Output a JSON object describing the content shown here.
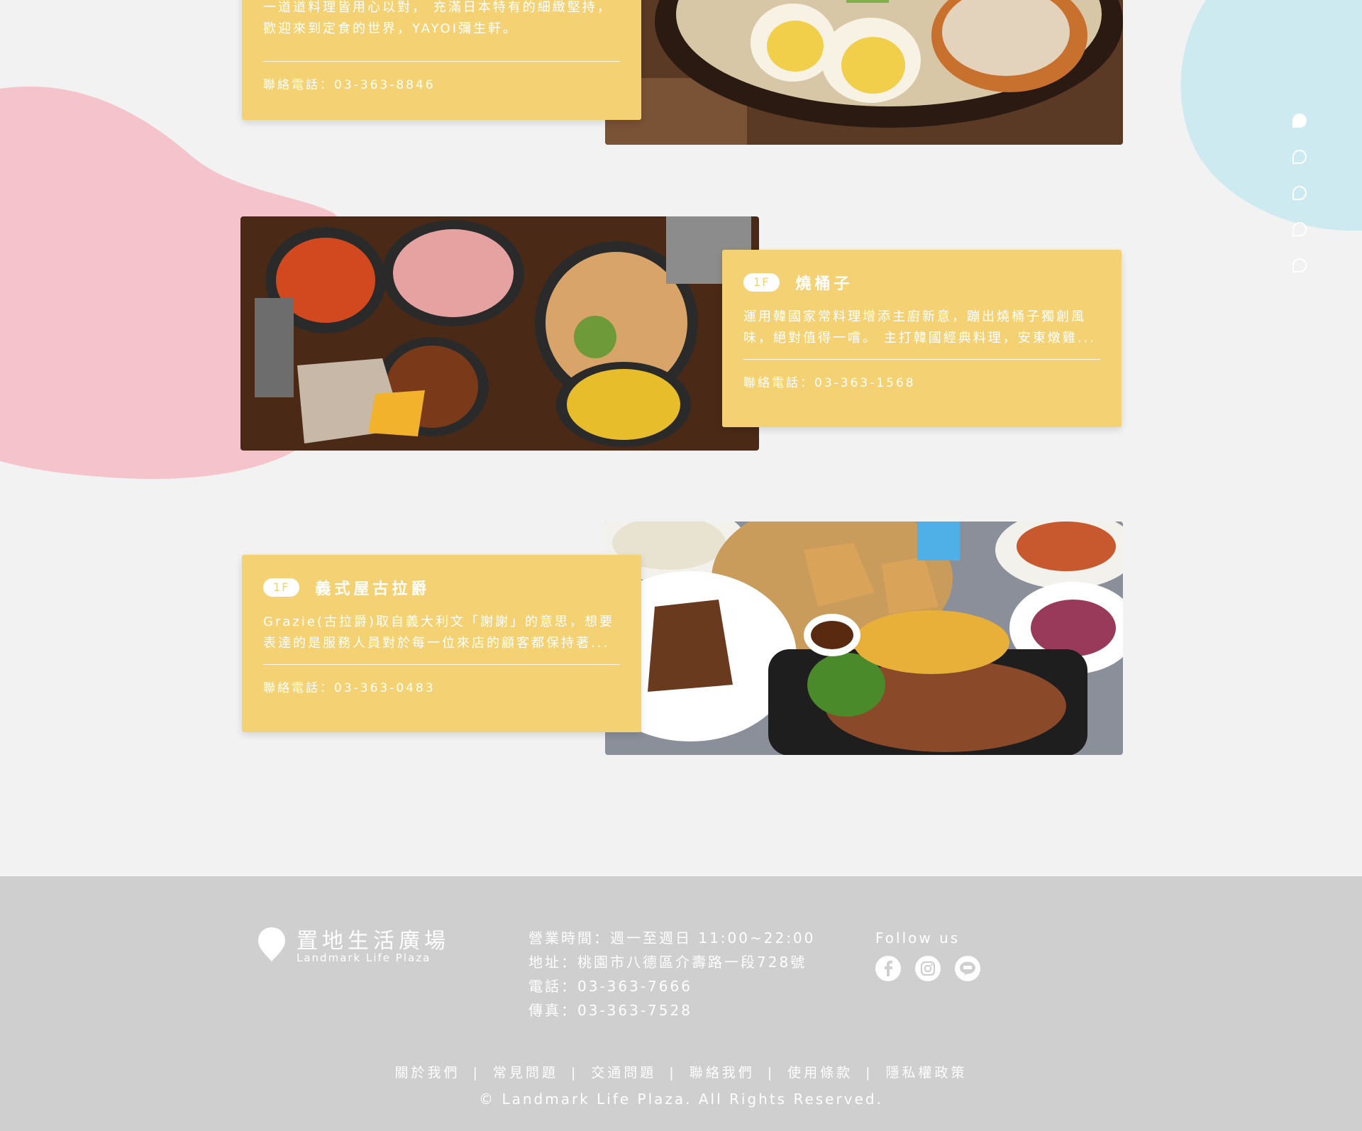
{
  "colors": {
    "background": "#f2f2f2",
    "card": "#f4d274",
    "pink_blob": "#f5c3cb",
    "blue_blob": "#cdeaf0",
    "footer": "#cfcfcf",
    "text_on_card": "#ffffff"
  },
  "side_nav": {
    "dots": [
      {
        "state": "active"
      },
      {
        "state": "idle"
      },
      {
        "state": "idle"
      },
      {
        "state": "idle"
      },
      {
        "state": "idle"
      }
    ]
  },
  "restaurants": [
    {
      "desc": "一道道料理皆用心以對， 充滿日本特有的細緻堅持， 歡迎來到定食的世界，YAYOI彌生軒。",
      "phone": "聯絡電話：03-363-8846",
      "photo_icon": "japanese-hotpot-photo"
    },
    {
      "floor": "1F",
      "name": "燒桶子",
      "desc": "運用韓國家常料理增添主廚新意，蹦出燒桶子獨創風味，絕對值得一嚐。 主打韓國經典料理，安東燉雞...",
      "phone": "聯絡電話：03-363-1568",
      "photo_icon": "korean-dishes-photo"
    },
    {
      "floor": "1F",
      "name": "義式屋古拉爵",
      "desc": "Grazie(古拉爵)取自義大利文「謝謝」的意思，想要表達的是服務人員對於每一位來店的顧客都保持著...",
      "phone": "聯絡電話：03-363-0483",
      "photo_icon": "italian-steak-photo"
    }
  ],
  "footer": {
    "logo_zh": "置地生活廣場",
    "logo_en": "Landmark Life Plaza",
    "info": [
      "營業時間：週一至週日 11:00~22:00",
      "地址：桃園市八德區介壽路一段728號",
      "電話：03-363-7666",
      "傳真：03-363-7528"
    ],
    "follow_title": "Follow us",
    "social_icons": [
      "facebook-icon",
      "instagram-icon",
      "line-icon"
    ],
    "links": [
      "關於我們",
      "常見問題",
      "交通問題",
      "聯絡我們",
      "使用條款",
      "隱私權政策"
    ],
    "link_separator": "|",
    "copyright": "© Landmark Life Plaza. All Rights Reserved."
  }
}
